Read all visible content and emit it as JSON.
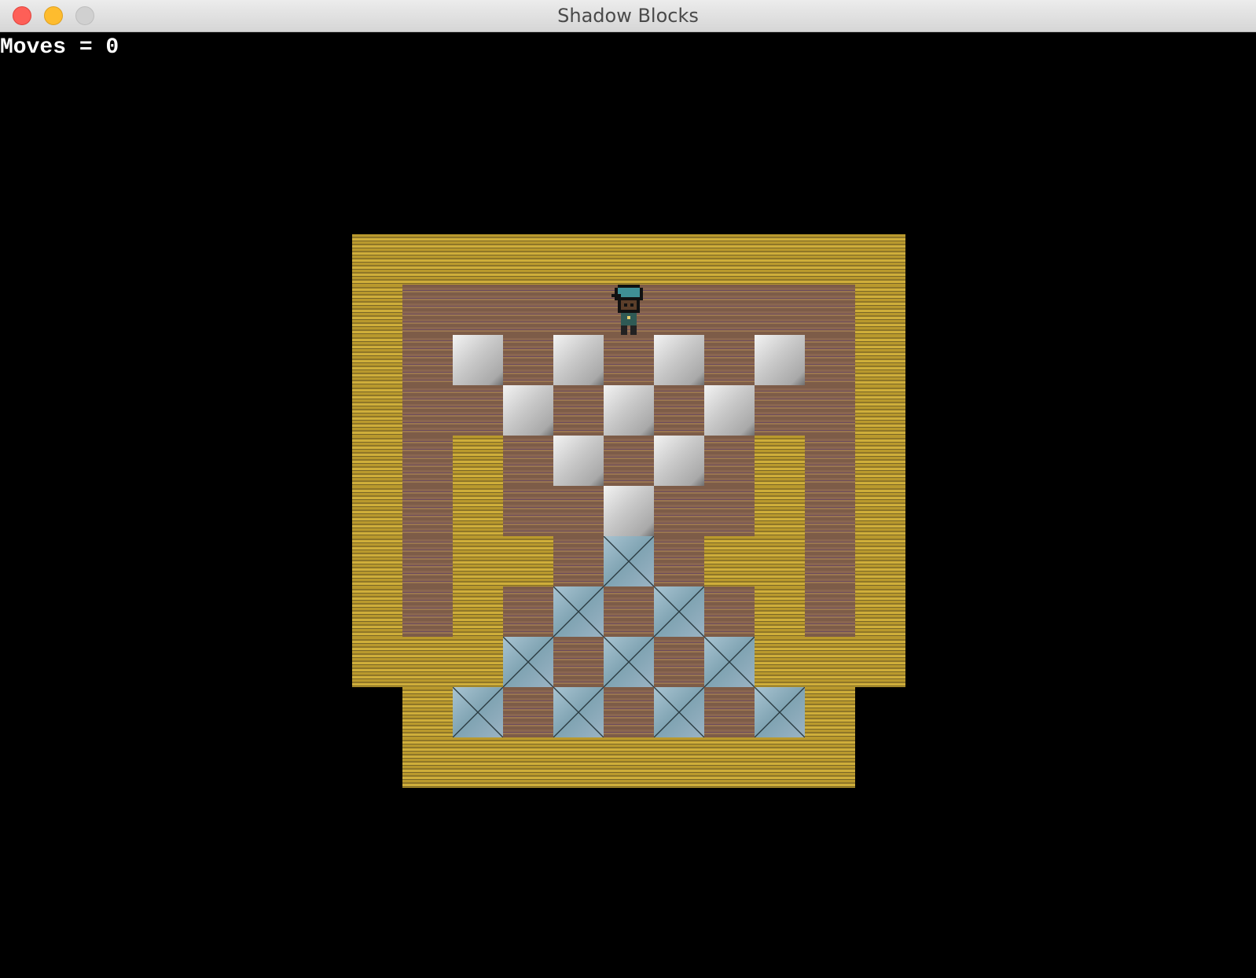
{
  "window": {
    "title": "Shadow Blocks"
  },
  "hud": {
    "moves_text": "Moves = 0",
    "moves": 0
  },
  "legend": {
    "W": "wall",
    "F": "floor",
    "B": "stone-block",
    "T": "target",
    "P": "player",
    ".": "empty"
  },
  "level": {
    "rows": [
      "WWWWWWWWWWW",
      "WFFFFPFFFFW",
      "WFBFBFBFBFW",
      "WFFBFBFBFFW",
      "WFWFBFBFWFW",
      "WFWFFBFFWFW",
      "WFWWFTFWWFW",
      "WFWFTFTFWFW",
      "WWWTFTFTWWW",
      ".WTFTFTFTW.",
      ".WWWWWWWWW."
    ]
  }
}
